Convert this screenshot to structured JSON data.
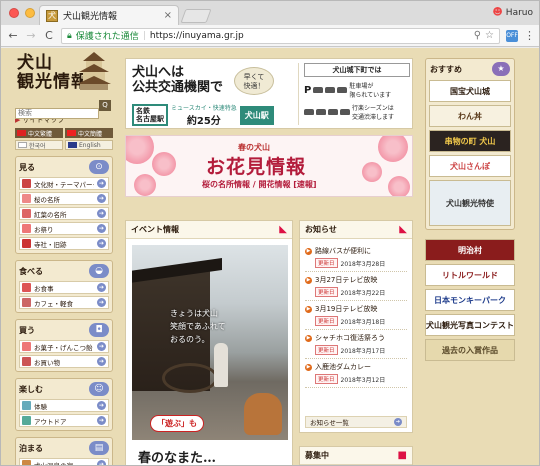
{
  "browser": {
    "tab_title": "犬山観光情報",
    "tab_close": "×",
    "user_name": "Haruo",
    "back": "←",
    "forward": "→",
    "reload": "C",
    "secure_label": "保護された通信",
    "url": "https://inuyama.gr.jp",
    "menu": "⋮"
  },
  "sidebar": {
    "logo_line1": "犬山",
    "logo_line2": "観光情報",
    "search_placeholder": "検索",
    "search_button": "Q",
    "sitemap": "サイトマップ",
    "languages": [
      "中文繁體",
      "中文簡體",
      "한국어",
      "English"
    ],
    "sections": [
      {
        "title": "見る",
        "color": "#7b8cc8",
        "icon": "binoculars-icon",
        "items": [
          "文化財・テーマパーク",
          "桜の名所",
          "紅葉の名所",
          "お祭り",
          "寺社・旧跡"
        ],
        "item_colors": [
          "#c44",
          "#e88",
          "#d66",
          "#e77",
          "#c33"
        ]
      },
      {
        "title": "食べる",
        "color": "#7b8cc8",
        "icon": "bowl-icon",
        "items": [
          "お食事",
          "カフェ・軽食"
        ],
        "item_colors": [
          "#d55",
          "#c66"
        ]
      },
      {
        "title": "買う",
        "color": "#7b8cc8",
        "icon": "bag-icon",
        "items": [
          "お菓子・げんこつ飴",
          "お買い物"
        ],
        "item_colors": [
          "#e77",
          "#c55"
        ]
      },
      {
        "title": "楽しむ",
        "color": "#7b8cc8",
        "icon": "fun-icon",
        "items": [
          "体験",
          "アウトドア"
        ],
        "item_colors": [
          "#6ab",
          "#5a9"
        ]
      },
      {
        "title": "泊まる",
        "color": "#7b8cc8",
        "icon": "bed-icon",
        "items": [
          "犬山温泉の宿"
        ],
        "item_colors": [
          "#c84"
        ]
      }
    ]
  },
  "banner_transport": {
    "title_line1": "犬山へは",
    "title_line2": "公共交通機関で",
    "quick": "早くて\n快適！",
    "from_line1": "名鉄",
    "from_line2": "名古屋駅",
    "express": "ミュースカイ・快速特急",
    "minutes": "約25分",
    "dest": "犬山駅",
    "right_title": "犬山城下町では",
    "right_row1": "駐車場が\n限られています",
    "right_row2": "行楽シーズンは\n交通渋滞します"
  },
  "banner_sakura": {
    "small": "春の犬山",
    "big": "お花見情報",
    "sub": "桜の名所情報 / 開花情報 [速報]"
  },
  "event": {
    "title": "イベント情報",
    "photo_text_line1": "きょうは犬山",
    "photo_text_line2": "笑顔であふれて",
    "photo_text_line3": "おるのう。",
    "badge": "「遊ぶ」も",
    "caption": "春のなまた…"
  },
  "news": {
    "title": "お知らせ",
    "update_label": "更新日",
    "items": [
      {
        "title": "路線バスが便利に",
        "date": "2018年3月28日"
      },
      {
        "title": "3月27日テレビ放映",
        "date": "2018年3月22日"
      },
      {
        "title": "3月19日テレビ放映",
        "date": "2018年3月18日"
      },
      {
        "title": "シャチホコ復活祭ろう",
        "date": "2018年3月17日"
      },
      {
        "title": "入鹿池ダムカレー",
        "date": "2018年3月12日"
      }
    ],
    "more": "お知らせ一覧"
  },
  "recruit": {
    "title": "募集中"
  },
  "right_sidebar": {
    "title": "おすすめ",
    "banners": [
      {
        "label": "国宝犬山城",
        "bg": "#ffffff",
        "fg": "#2b1a0c"
      },
      {
        "label": "わん丼",
        "bg": "#f7f1e0",
        "fg": "#5a3a1a"
      },
      {
        "label": "串物の町 犬山",
        "bg": "#2b2320",
        "fg": "#f1c84b"
      },
      {
        "label": "犬山さんぽ",
        "bg": "#ffffff",
        "fg": "#c44"
      },
      {
        "label": "犬山観光特使",
        "bg": "#e8eef2",
        "fg": "#333"
      }
    ],
    "banners2": [
      {
        "label": "明治村",
        "bg": "#8a1c1c",
        "fg": "#ffffff"
      },
      {
        "label": "リトルワールド",
        "bg": "#ffffff",
        "fg": "#8a1c1c"
      },
      {
        "label": "日本モンキーパーク",
        "bg": "#ffffff",
        "fg": "#1c3a8a"
      },
      {
        "label": "犬山観光写真コンテスト",
        "bg": "#ffffff",
        "fg": "#2b1a0c"
      },
      {
        "label": "過去の入賞作品",
        "bg": "#e6d9ad",
        "fg": "#5a4a2a"
      }
    ]
  },
  "colors": {
    "accent": "#2e8b7a",
    "sakura": "#b31c3b",
    "page_bg": "#e9dcb5"
  }
}
